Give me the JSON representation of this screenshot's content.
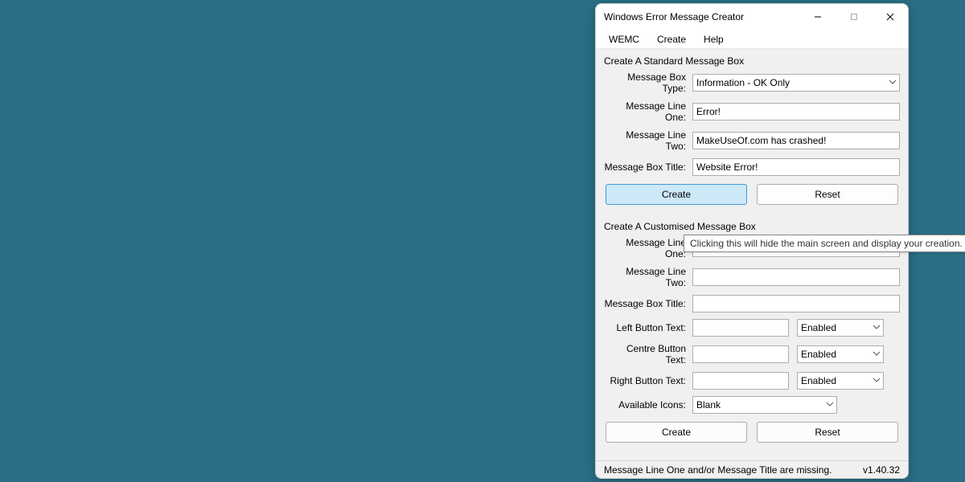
{
  "titlebar": {
    "title": "Windows Error Message Creator"
  },
  "menubar": {
    "items": [
      "WEMC",
      "Create",
      "Help"
    ]
  },
  "standard": {
    "group_title": "Create A Standard Message Box",
    "type_label": "Message Box Type:",
    "type_value": "Information - OK Only",
    "line1_label": "Message Line One:",
    "line1_value": "Error!",
    "line2_label": "Message Line Two:",
    "line2_value": "MakeUseOf.com has crashed!",
    "title_label": "Message Box Title:",
    "title_value": "Website Error!",
    "create_btn": "Create",
    "reset_btn": "Reset"
  },
  "custom": {
    "group_title": "Create A Customised Message Box",
    "line1_label": "Message Line One:",
    "line1_value": "",
    "line2_label": "Message Line Two:",
    "line2_value": "",
    "title_label": "Message Box Title:",
    "title_value": "",
    "left_label": "Left Button Text:",
    "left_value": "",
    "left_state": "Enabled",
    "centre_label": "Centre Button Text:",
    "centre_value": "",
    "centre_state": "Enabled",
    "right_label": "Right Button Text:",
    "right_value": "",
    "right_state": "Enabled",
    "icons_label": "Available Icons:",
    "icons_value": "Blank",
    "create_btn": "Create",
    "reset_btn": "Reset"
  },
  "status": {
    "message": "Message Line One and/or Message Title are missing.",
    "version": "v1.40.32"
  },
  "tooltip": "Clicking this will hide the main screen and display your creation."
}
